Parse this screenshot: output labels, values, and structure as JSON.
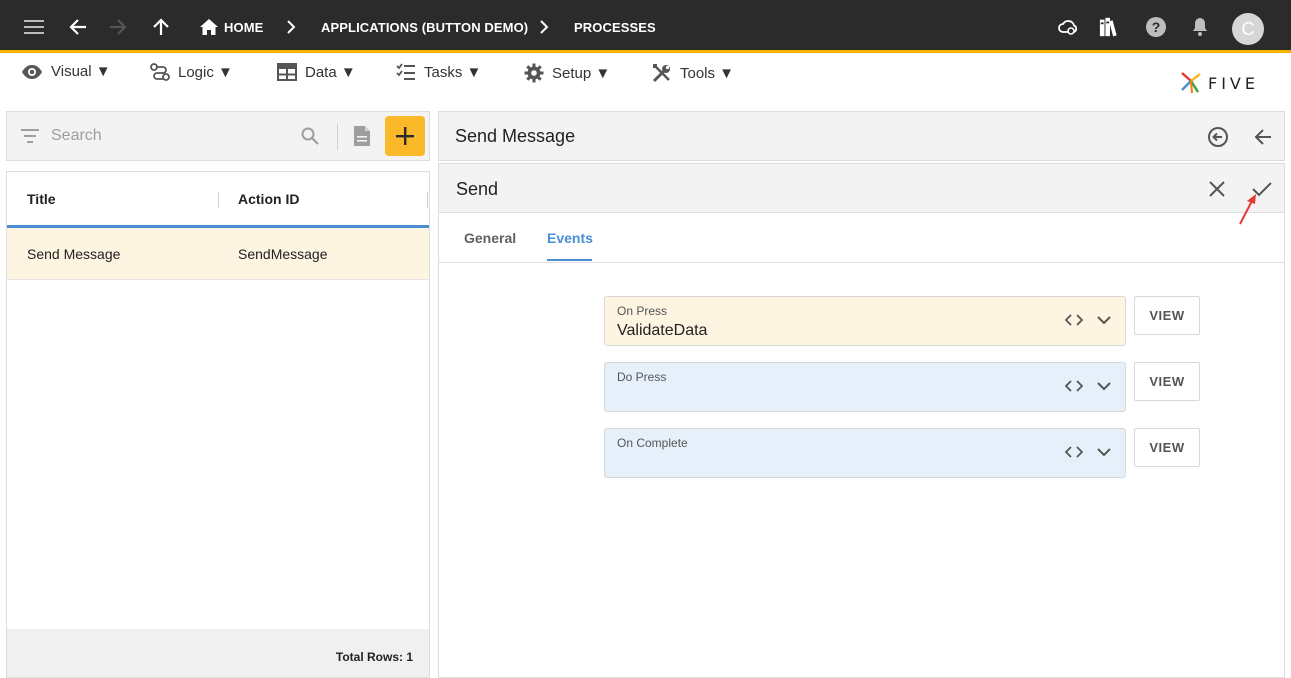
{
  "topbar": {
    "breadcrumbs": [
      "HOME",
      "APPLICATIONS (BUTTON DEMO)",
      "PROCESSES"
    ],
    "avatar_letter": "C"
  },
  "menu": {
    "items": [
      {
        "label": "Visual ▼",
        "icon": "eye-icon"
      },
      {
        "label": "Logic ▼",
        "icon": "logic-icon"
      },
      {
        "label": "Data ▼",
        "icon": "table-icon"
      },
      {
        "label": "Tasks ▼",
        "icon": "checklist-icon"
      },
      {
        "label": "Setup ▼",
        "icon": "gear-icon"
      },
      {
        "label": "Tools ▼",
        "icon": "tools-icon"
      }
    ]
  },
  "brand": {
    "name": "FIVE"
  },
  "list": {
    "search_placeholder": "Search",
    "columns": [
      "Title",
      "Action ID"
    ],
    "rows": [
      {
        "title": "Send Message",
        "action_id": "SendMessage"
      }
    ],
    "footer": "Total Rows: 1"
  },
  "detail": {
    "title": "Send Message",
    "form_title": "Send",
    "tabs": [
      "General",
      "Events"
    ],
    "active_tab": "Events",
    "fields": [
      {
        "label": "On Press",
        "value": "ValidateData",
        "button": "VIEW"
      },
      {
        "label": "Do Press",
        "value": "",
        "button": "VIEW"
      },
      {
        "label": "On Complete",
        "value": "",
        "button": "VIEW"
      }
    ]
  },
  "colors": {
    "topbar": "#2b2b2b",
    "accent_yellow": "#f9b928",
    "accent_blue": "#4a8fd4",
    "selected_row": "#fdf4e1",
    "field_blue": "#e6f0fa",
    "annotation_arrow": "#e53935"
  }
}
